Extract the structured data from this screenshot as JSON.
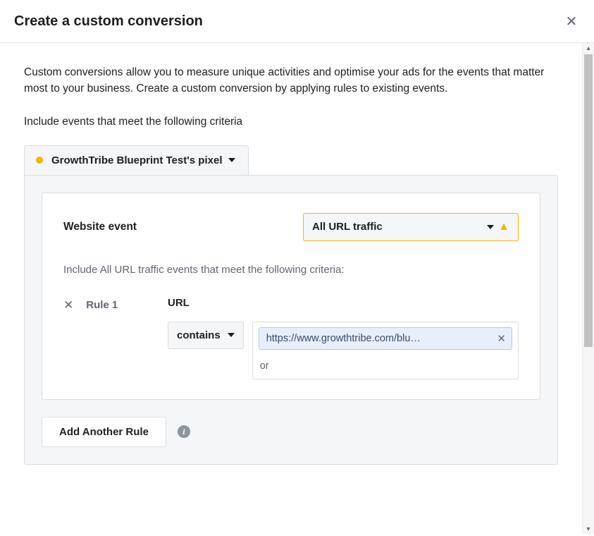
{
  "modal": {
    "title": "Create a custom conversion",
    "description": "Custom conversions allow you to measure unique activities and optimise your ads for the events that matter most to your business. Create a custom conversion by applying rules to existing events.",
    "criteria_label": "Include events that meet the following criteria"
  },
  "pixel": {
    "name": "GrowthTribe Blueprint Test's pixel"
  },
  "rule_card": {
    "website_event_label": "Website event",
    "event_selected": "All URL traffic",
    "criteria_sub": "Include All URL traffic events that meet the following criteria:",
    "rule_name": "Rule 1",
    "url_label": "URL",
    "contains_label": "contains",
    "url_chip": "https://www.growthtribe.com/blu…",
    "or_label": "or"
  },
  "footer": {
    "add_rule_label": "Add Another Rule"
  }
}
